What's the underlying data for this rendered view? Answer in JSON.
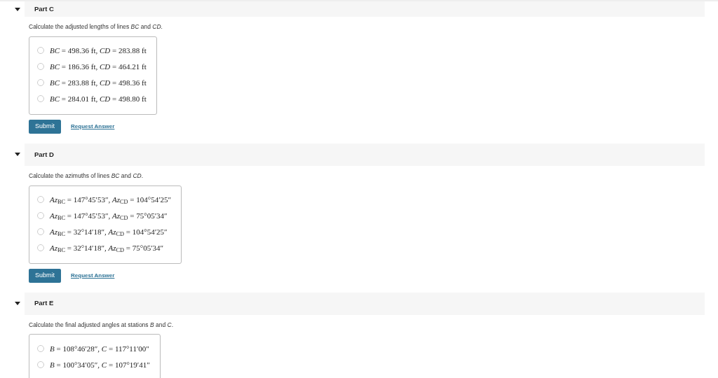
{
  "parts": [
    {
      "title": "Part C",
      "expanded": true,
      "question": "Calculate the adjusted lengths of lines *BC* and *CD*.",
      "options": [
        {
          "text": "*BC* = 498.36 ft, *CD* = 283.88 ft",
          "selected": false
        },
        {
          "text": "*BC* = 186.36 ft, *CD* = 464.21 ft",
          "selected": false
        },
        {
          "text": "*BC* = 283.88 ft, *CD* = 498.36 ft",
          "selected": false
        },
        {
          "text": "*BC* = 284.01 ft, *CD* = 498.80 ft",
          "selected": false
        }
      ],
      "submit": "Submit",
      "request": "Request Answer"
    },
    {
      "title": "Part D",
      "expanded": true,
      "question": "Calculate the azimuths of lines *BC* and *CD*.",
      "options": [
        {
          "text": "*Az*$_{BC}$ = 147°45′53″, *Az*$_{CD}$ = 104°54′25″",
          "selected": false
        },
        {
          "text": "*Az*$_{BC}$ = 147°45′53″, *Az*$_{CD}$ = 75°05′34″",
          "selected": false
        },
        {
          "text": "*Az*$_{BC}$ = 32°14′18″, *Az*$_{CD}$ = 104°54′25″",
          "selected": false
        },
        {
          "text": "*Az*$_{BC}$ = 32°14′18″, *Az*$_{CD}$ = 75°05′34″",
          "selected": false
        }
      ],
      "submit": "Submit",
      "request": "Request Answer"
    },
    {
      "title": "Part E",
      "expanded": true,
      "question": "Calculate the final adjusted angles at stations *B* and *C*.",
      "options": [
        {
          "text": "*B* = 108°46′28″, *C* = 117°11′00″",
          "selected": false
        },
        {
          "text": "*B* = 100°34′05″, *C* = 107°19′41″",
          "selected": false
        }
      ]
    }
  ]
}
